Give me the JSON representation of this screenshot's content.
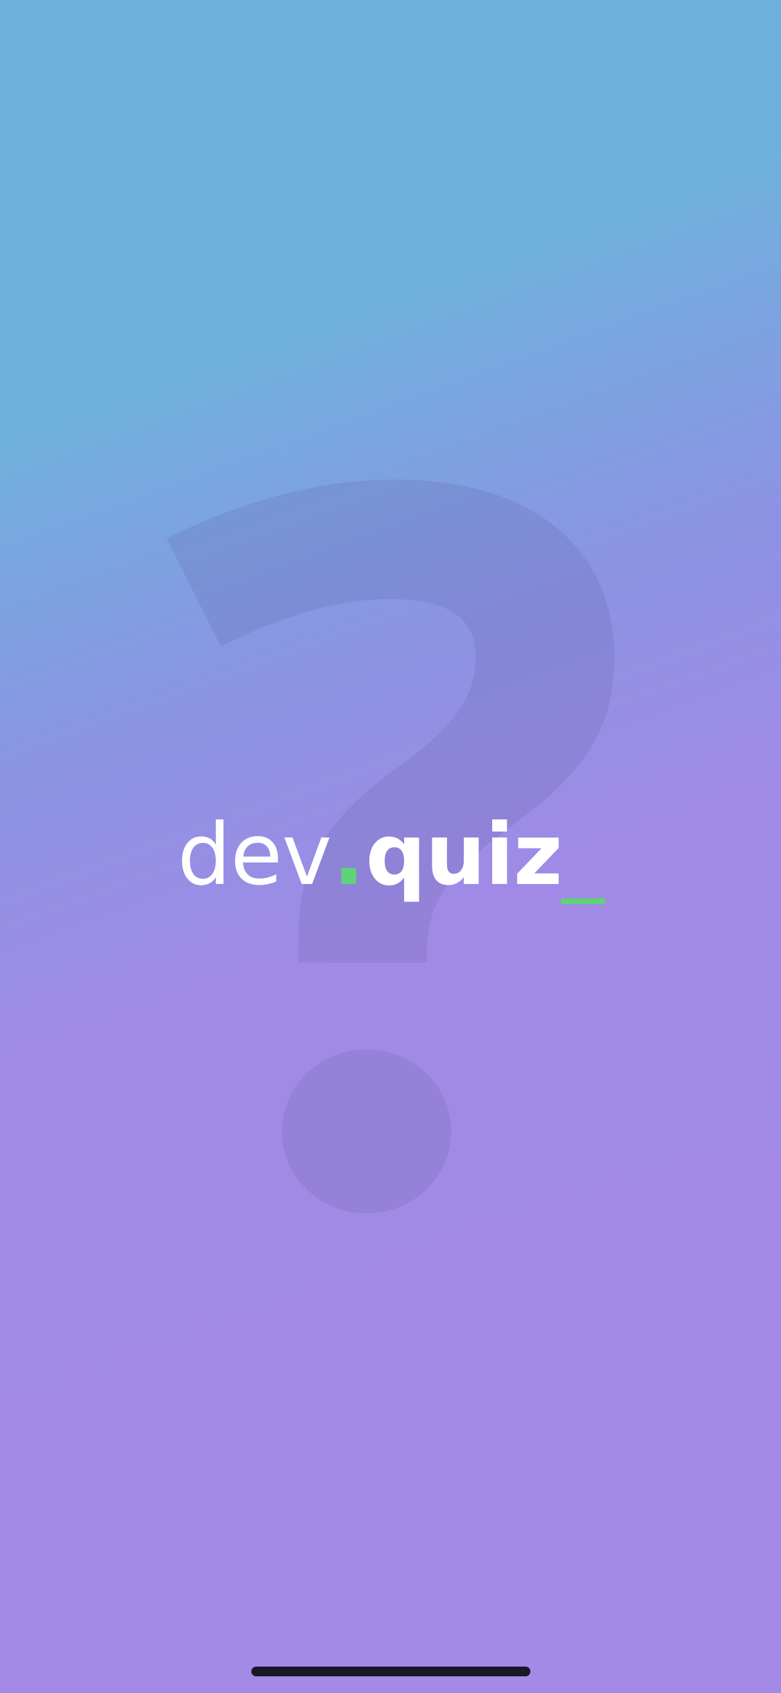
{
  "app": {
    "logo": {
      "part1": "dev",
      "separator": ".",
      "part2": "quiz",
      "cursor": "_"
    },
    "background_symbol": "?",
    "colors": {
      "gradient_start": "#6eb0de",
      "gradient_end": "#a28ae6",
      "accent": "#5fd27a",
      "text": "#ffffff",
      "home_indicator": "#1b1726"
    }
  }
}
